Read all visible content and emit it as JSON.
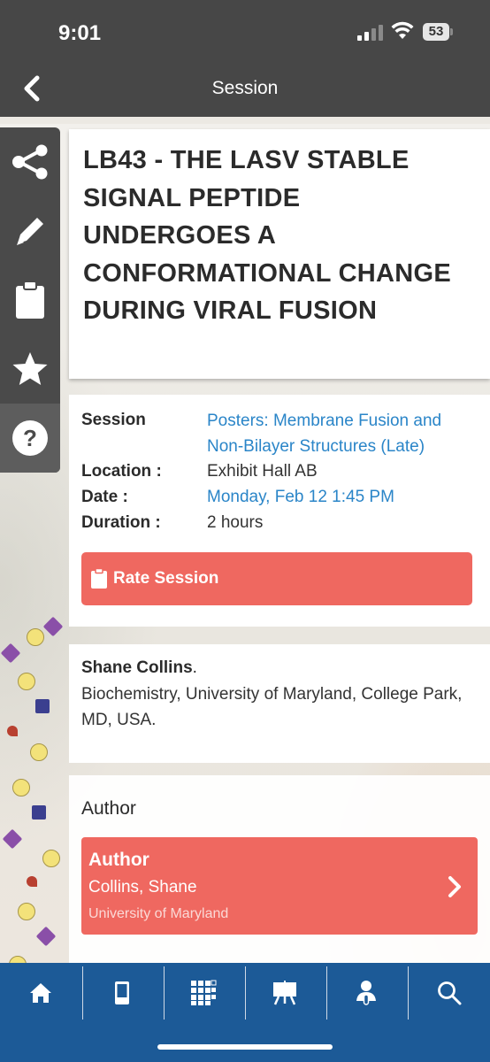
{
  "status": {
    "time": "9:01",
    "battery": "53"
  },
  "nav": {
    "title": "Session"
  },
  "sidebar": {
    "items": [
      {
        "icon": "share-icon"
      },
      {
        "icon": "pencil-icon"
      },
      {
        "icon": "clipboard-icon"
      },
      {
        "icon": "star-icon"
      },
      {
        "icon": "help-icon"
      }
    ]
  },
  "session": {
    "title": "LB43 - THE LASV STABLE SIGNAL PEPTIDE UNDERGOES A CONFORMATIONAL CHANGE DURING VIRAL FUSION",
    "session_label": "Session",
    "session_value_line1": "Posters: Membrane Fusion and",
    "session_value_line2": "Non-Bilayer Structures (Late)",
    "location_label": "Location :",
    "location_value": "Exhibit Hall AB",
    "date_label": "Date :",
    "date_value": "Monday, Feb 12 1:45 PM",
    "duration_label": "Duration :",
    "duration_value": "2 hours",
    "rate_label": "Rate Session"
  },
  "presenter": {
    "name": "Shane Collins",
    "punct": ".",
    "affiliation": "Biochemistry, University of Maryland, College Park, MD, USA."
  },
  "authors": {
    "heading": "Author",
    "items": [
      {
        "role": "Author",
        "name": "Collins, Shane",
        "institution": "University of Maryland"
      }
    ]
  },
  "tabbar": {
    "items": [
      {
        "icon": "home-icon"
      },
      {
        "icon": "mobile-icon"
      },
      {
        "icon": "grid-icon"
      },
      {
        "icon": "presentation-icon"
      },
      {
        "icon": "speaker-icon"
      },
      {
        "icon": "search-icon"
      }
    ]
  },
  "colors": {
    "accent": "#ef6860",
    "link": "#2a85c8",
    "tabbar": "#1c5a97",
    "header": "#474747"
  }
}
